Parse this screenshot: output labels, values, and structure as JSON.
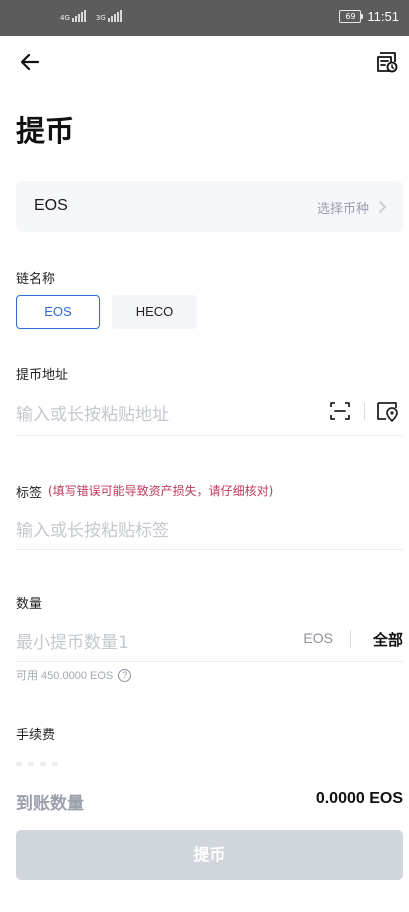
{
  "status_bar": {
    "network_1": "4G",
    "network_2": "3G",
    "battery": "69",
    "time": "11:51"
  },
  "header": {
    "back_icon": "arrow-left-icon",
    "history_icon": "withdraw-records-icon",
    "title": "提币"
  },
  "coin_select": {
    "coin": "EOS",
    "hint": "选择币种",
    "chevron_icon": "chevron-right-icon"
  },
  "chain": {
    "label": "链名称",
    "options": [
      "EOS",
      "HECO"
    ],
    "selected": "EOS"
  },
  "address": {
    "label": "提币地址",
    "placeholder": "输入或长按粘贴地址",
    "scan_icon": "scan-icon",
    "address_book_icon": "address-book-icon"
  },
  "tag": {
    "label": "标签",
    "warning": "(填写错误可能导致资产损失，请仔细核对)",
    "placeholder": "输入或长按粘贴标签"
  },
  "amount": {
    "label": "数量",
    "placeholder": "最小提币数量1",
    "unit": "EOS",
    "all_label": "全部",
    "available": "可用 450.0000 EOS",
    "help_icon": "help-circle-icon"
  },
  "fee": {
    "label": "手续费"
  },
  "receive": {
    "label": "到账数量",
    "value": "0.0000 EOS"
  },
  "submit": {
    "label": "提币"
  },
  "colors": {
    "accent": "#2f6ad6",
    "warning": "#c0395a",
    "disabled_button": "#d1d6dd",
    "status_bar": "#5c5c5c"
  }
}
